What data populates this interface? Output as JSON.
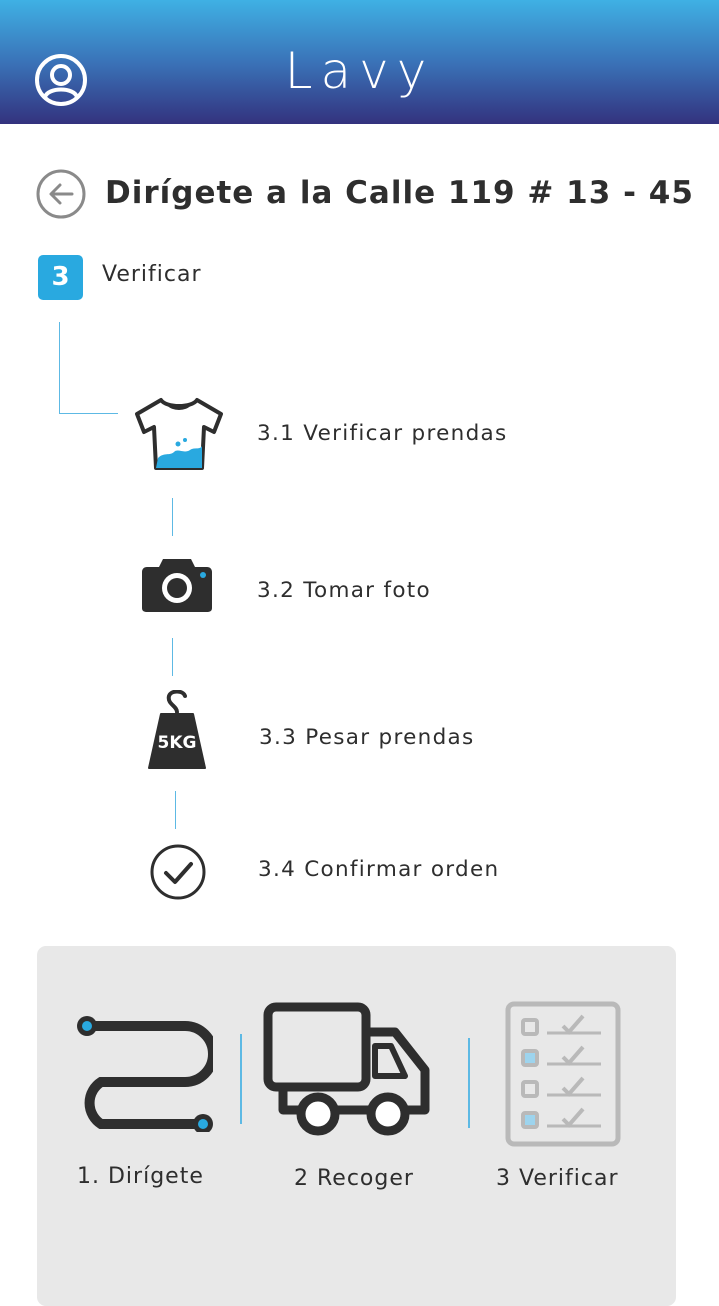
{
  "app": {
    "brand": "Lavy"
  },
  "header": {
    "avatar_icon": "user-circle-icon"
  },
  "page": {
    "title": "Dirígete a la Calle 119 # 13 - 45",
    "back_icon": "arrow-left-circle-icon"
  },
  "step": {
    "number": "3",
    "label": "Verificar"
  },
  "substeps": [
    {
      "label": "3.1 Verificar prendas",
      "icon": "tshirt-icon"
    },
    {
      "label": "3.2 Tomar foto",
      "icon": "camera-icon"
    },
    {
      "label": "3.3 Pesar prendas",
      "icon": "weight-icon",
      "weight_text": "5KG"
    },
    {
      "label": "3.4 Confirmar orden",
      "icon": "check-circle-icon"
    }
  ],
  "tabs": [
    {
      "label": "1. Dirígete",
      "icon": "route-icon"
    },
    {
      "label": "2 Recoger",
      "icon": "truck-icon"
    },
    {
      "label": "3 Verificar",
      "icon": "checklist-icon"
    }
  ],
  "colors": {
    "accent": "#29a9e0",
    "header_top": "#3fb1e4",
    "header_bottom": "#33327e",
    "text": "#2e2e2e",
    "panel": "#e8e8e8"
  }
}
